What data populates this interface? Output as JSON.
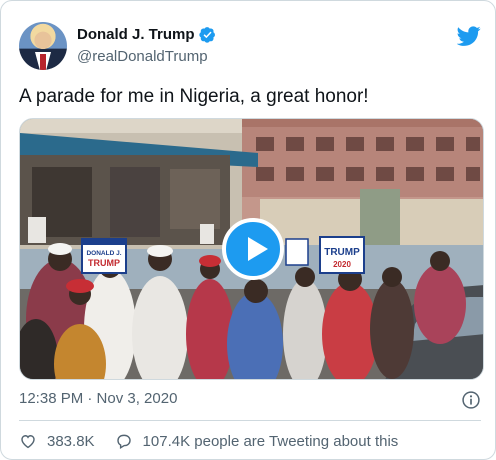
{
  "tweet": {
    "author_name": "Donald J. Trump",
    "handle": "@realDonaldTrump",
    "text": "A parade for me in Nigeria, a great honor!",
    "timestamp": "12:38 PM · Nov 3, 2020",
    "likes": "383.8K",
    "conversation": "107.4K people are Tweeting about this"
  },
  "media": {
    "signs": [
      "DONALD J. TRUMP",
      "TRUMP 2020"
    ]
  },
  "icons": {
    "brand": "twitter-bird-icon",
    "verified": "verified-badge-icon",
    "play": "play-icon",
    "info": "info-icon",
    "like": "heart-icon",
    "conversation": "reply-bubble-icon"
  },
  "colors": {
    "accent": "#1d9bf0",
    "text": "#0f1419",
    "secondary": "#536471",
    "border": "#cfd9de"
  }
}
